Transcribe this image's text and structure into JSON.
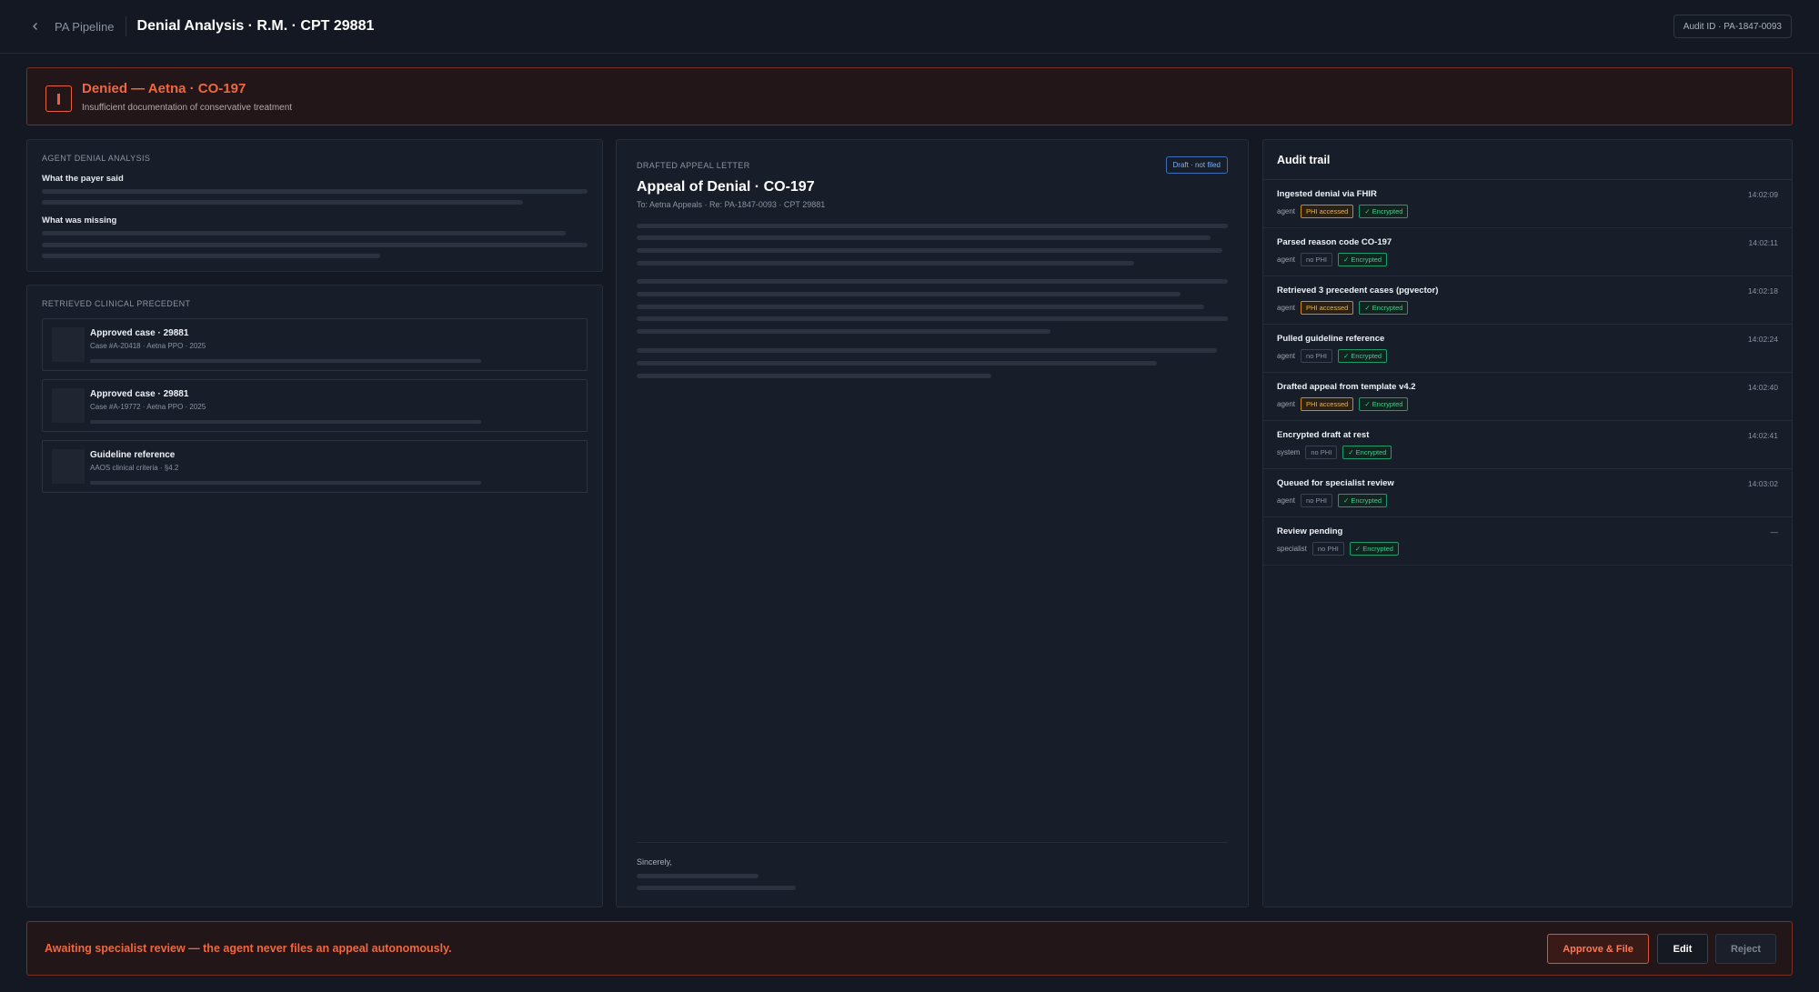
{
  "header": {
    "breadcrumb": "PA Pipeline",
    "title": "Denial Analysis · R.M. · CPT 29881",
    "audit_id": "Audit ID · PA-1847-0093"
  },
  "denial": {
    "title": "Denied — Aetna · CO-197",
    "subtitle": "Insufficient documentation of conservative treatment"
  },
  "analysis": {
    "label": "Agent denial analysis",
    "payer_said": "What the payer said",
    "missing": "What was missing"
  },
  "precedent": {
    "label": "Retrieved clinical precedent",
    "cards": [
      {
        "title": "Approved case · 29881",
        "subtitle": "Case #A-20418 · Aetna PPO · 2025"
      },
      {
        "title": "Approved case · 29881",
        "subtitle": "Case #A-19772 · Aetna PPO · 2025"
      },
      {
        "title": "Guideline reference",
        "subtitle": "AAOS clinical criteria · §4.2"
      }
    ]
  },
  "letter": {
    "label": "Drafted appeal letter",
    "badge": "Draft · not filed",
    "title": "Appeal of Denial · CO-197",
    "to": "To: Aetna Appeals · Re: PA-1847-0093 · CPT 29881",
    "closing": "Sincerely,"
  },
  "audit": {
    "title": "Audit trail",
    "rows": [
      {
        "title": "Ingested denial via FHIR",
        "time": "14:02:09",
        "actor": "agent",
        "phi": "PHI accessed",
        "enc": "✓ Encrypted"
      },
      {
        "title": "Parsed reason code CO-197",
        "time": "14:02:11",
        "actor": "agent",
        "phi": "no PHI",
        "enc": "✓ Encrypted"
      },
      {
        "title": "Retrieved 3 precedent cases (pgvector)",
        "time": "14:02:18",
        "actor": "agent",
        "phi": "PHI accessed",
        "enc": "✓ Encrypted"
      },
      {
        "title": "Pulled guideline reference",
        "time": "14:02:24",
        "actor": "agent",
        "phi": "no PHI",
        "enc": "✓ Encrypted"
      },
      {
        "title": "Drafted appeal from template v4.2",
        "time": "14:02:40",
        "actor": "agent",
        "phi": "PHI accessed",
        "enc": "✓ Encrypted"
      },
      {
        "title": "Encrypted draft at rest",
        "time": "14:02:41",
        "actor": "system",
        "phi": "no PHI",
        "enc": "✓ Encrypted"
      },
      {
        "title": "Queued for specialist review",
        "time": "14:03:02",
        "actor": "agent",
        "phi": "no PHI",
        "enc": "✓ Encrypted"
      },
      {
        "title": "Review pending",
        "time": "—",
        "actor": "specialist",
        "phi": "no PHI",
        "enc": "✓ Encrypted"
      }
    ]
  },
  "footer": {
    "message": "Awaiting specialist review — the agent never files an appeal autonomously.",
    "approve": "Approve & File",
    "edit": "Edit",
    "reject": "Reject"
  }
}
